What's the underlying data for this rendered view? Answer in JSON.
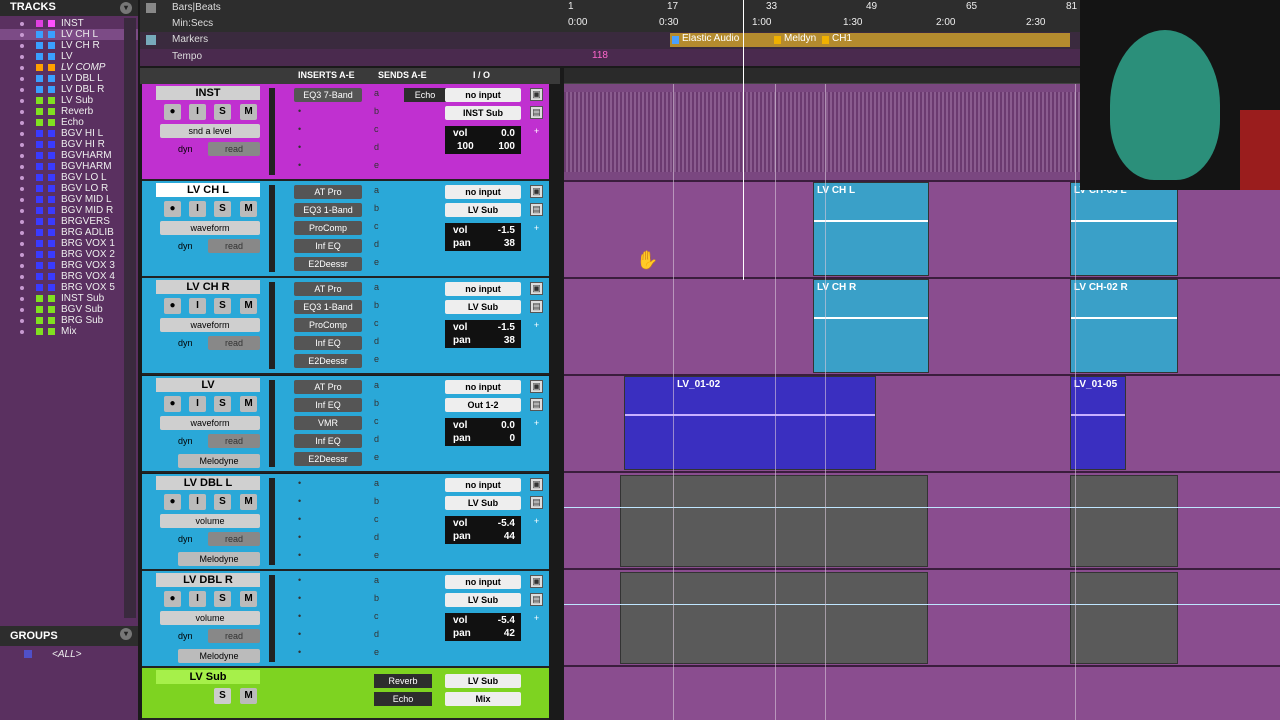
{
  "tracks_panel": {
    "title": "TRACKS",
    "items": [
      {
        "name": "INST",
        "c1": "#e040e0",
        "c2": "#ff50ff",
        "sel": false,
        "it": false
      },
      {
        "name": "LV CH L",
        "c1": "#3aa0ff",
        "c2": "#3aa0ff",
        "sel": true,
        "it": false
      },
      {
        "name": "LV CH R",
        "c1": "#3aa0ff",
        "c2": "#3aa0ff",
        "sel": false,
        "it": false
      },
      {
        "name": "LV",
        "c1": "#3aa0ff",
        "c2": "#3aa0ff",
        "sel": false,
        "it": false
      },
      {
        "name": "LV COMP",
        "c1": "#ffa000",
        "c2": "#ffa000",
        "sel": false,
        "it": true
      },
      {
        "name": "LV DBL L",
        "c1": "#3aa0ff",
        "c2": "#3aa0ff",
        "sel": false,
        "it": false
      },
      {
        "name": "LV DBL R",
        "c1": "#3aa0ff",
        "c2": "#3aa0ff",
        "sel": false,
        "it": false
      },
      {
        "name": "LV Sub",
        "c1": "#80e020",
        "c2": "#80e020",
        "sel": false,
        "it": false
      },
      {
        "name": "Reverb",
        "c1": "#80e020",
        "c2": "#80e020",
        "sel": false,
        "it": false
      },
      {
        "name": "Echo",
        "c1": "#80e020",
        "c2": "#80e020",
        "sel": false,
        "it": false
      },
      {
        "name": "BGV HI L",
        "c1": "#3a3aff",
        "c2": "#3a3aff",
        "sel": false,
        "it": false
      },
      {
        "name": "BGV HI R",
        "c1": "#3a3aff",
        "c2": "#3a3aff",
        "sel": false,
        "it": false
      },
      {
        "name": "BGVHARM",
        "c1": "#3a3aff",
        "c2": "#3a3aff",
        "sel": false,
        "it": false
      },
      {
        "name": "BGVHARM",
        "c1": "#3a3aff",
        "c2": "#3a3aff",
        "sel": false,
        "it": false
      },
      {
        "name": "BGV LO L",
        "c1": "#3a3aff",
        "c2": "#3a3aff",
        "sel": false,
        "it": false
      },
      {
        "name": "BGV LO R",
        "c1": "#3a3aff",
        "c2": "#3a3aff",
        "sel": false,
        "it": false
      },
      {
        "name": "BGV MID L",
        "c1": "#3a3aff",
        "c2": "#3a3aff",
        "sel": false,
        "it": false
      },
      {
        "name": "BGV MID R",
        "c1": "#3a3aff",
        "c2": "#3a3aff",
        "sel": false,
        "it": false
      },
      {
        "name": "BRGVERS",
        "c1": "#3a3aff",
        "c2": "#3a3aff",
        "sel": false,
        "it": false
      },
      {
        "name": "BRG ADLIB",
        "c1": "#3a3aff",
        "c2": "#3a3aff",
        "sel": false,
        "it": false
      },
      {
        "name": "BRG VOX 1",
        "c1": "#3a3aff",
        "c2": "#3a3aff",
        "sel": false,
        "it": false
      },
      {
        "name": "BRG VOX 2",
        "c1": "#3a3aff",
        "c2": "#3a3aff",
        "sel": false,
        "it": false
      },
      {
        "name": "BRG VOX 3",
        "c1": "#3a3aff",
        "c2": "#3a3aff",
        "sel": false,
        "it": false
      },
      {
        "name": "BRG VOX 4",
        "c1": "#3a3aff",
        "c2": "#3a3aff",
        "sel": false,
        "it": false
      },
      {
        "name": "BRG VOX 5",
        "c1": "#3a3aff",
        "c2": "#3a3aff",
        "sel": false,
        "it": false
      },
      {
        "name": "INST Sub",
        "c1": "#80e020",
        "c2": "#80e020",
        "sel": false,
        "it": false
      },
      {
        "name": "BGV Sub",
        "c1": "#80e020",
        "c2": "#80e020",
        "sel": false,
        "it": false
      },
      {
        "name": "BRG Sub",
        "c1": "#80e020",
        "c2": "#80e020",
        "sel": false,
        "it": false
      },
      {
        "name": "Mix",
        "c1": "#80e020",
        "c2": "#80e020",
        "sel": false,
        "it": false
      }
    ]
  },
  "groups_panel": {
    "title": "GROUPS",
    "all": "<ALL>"
  },
  "rulers": {
    "bars_beats": "Bars|Beats",
    "min_secs": "Min:Secs",
    "markers": "Markers",
    "tempo": "Tempo",
    "tempo_value": "118",
    "bar_ticks": [
      "1",
      "17",
      "33",
      "49",
      "65",
      "81"
    ],
    "time_ticks": [
      "0:00",
      "0:30",
      "1:00",
      "1:30",
      "2:00",
      "2:30"
    ],
    "marker_list": [
      "Elastic Audio",
      "Meldyn",
      "CH1"
    ]
  },
  "columns": {
    "inserts": "INSERTS A-E",
    "sends": "SENDS A-E",
    "io": "I / O"
  },
  "tracks": [
    {
      "name": "INST",
      "color": "#c030d0",
      "mode": "snd a level",
      "inserts": [
        "EQ3 7-Band",
        "",
        "",
        "",
        ""
      ],
      "sends": [
        "Echo",
        "",
        "",
        "",
        ""
      ],
      "input": "no input",
      "output": "INST Sub",
      "vol": "0.0",
      "pan_l": "100",
      "pan_r": "100",
      "row2": "",
      "plugin": ""
    },
    {
      "name": "LV CH L",
      "color": "#2aa8d8",
      "mode": "waveform",
      "inserts": [
        "AT Pro",
        "EQ3 1-Band",
        "ProComp",
        "Inf EQ",
        "E2Deessr"
      ],
      "sends": [
        "",
        "",
        "",
        "",
        ""
      ],
      "input": "no input",
      "output": "LV Sub",
      "vol": "-1.5",
      "pan": "38",
      "panlabel": "pan",
      "row2": "",
      "plugin": ""
    },
    {
      "name": "LV CH R",
      "color": "#2aa8d8",
      "mode": "waveform",
      "inserts": [
        "AT Pro",
        "EQ3 1-Band",
        "ProComp",
        "Inf EQ",
        "E2Deessr"
      ],
      "sends": [
        "",
        "",
        "",
        "",
        ""
      ],
      "input": "no input",
      "output": "LV Sub",
      "vol": "-1.5",
      "pan": "38",
      "panlabel": "pan",
      "row2": "",
      "plugin": ""
    },
    {
      "name": "LV",
      "color": "#2aa8d8",
      "mode": "waveform",
      "inserts": [
        "AT Pro",
        "Inf EQ",
        "VMR",
        "Inf EQ",
        "E2Deessr"
      ],
      "sends": [
        "",
        "",
        "",
        "",
        ""
      ],
      "input": "no input",
      "output": "Out 1-2",
      "vol": "0.0",
      "pan": "0",
      "panlabel": "pan",
      "row2": "",
      "plugin": "Melodyne"
    },
    {
      "name": "LV DBL L",
      "color": "#2aa8d8",
      "mode": "volume",
      "inserts": [
        "",
        "",
        "",
        "",
        ""
      ],
      "sends": [
        "",
        "",
        "",
        "",
        ""
      ],
      "input": "no input",
      "output": "LV Sub",
      "vol": "-5.4",
      "pan": "44",
      "panlabel": "pan",
      "row2": "",
      "plugin": "Melodyne"
    },
    {
      "name": "LV DBL R",
      "color": "#2aa8d8",
      "mode": "volume",
      "inserts": [
        "",
        "",
        "",
        "",
        ""
      ],
      "sends": [
        "",
        "",
        "",
        "",
        ""
      ],
      "input": "no input",
      "output": "LV Sub",
      "vol": "-5.4",
      "pan": "42",
      "panlabel": "pan",
      "row2": "",
      "plugin": "Melodyne"
    }
  ],
  "lv_sub": {
    "name": "LV Sub",
    "send_a": "Reverb",
    "send_b": "Echo",
    "input": "LV Sub",
    "output": "Mix"
  },
  "track_labels": {
    "vol": "vol",
    "dyn": "dyn",
    "read": "read",
    "slots": [
      "a",
      "b",
      "c",
      "d",
      "e"
    ]
  },
  "clips": {
    "lvchl_a": "LV CH L",
    "lvchl_b": "LV CH-03 L",
    "lvchr_a": "LV CH R",
    "lvchr_b": "LV CH-02 R",
    "lv_a": "LV_01-02",
    "lv_b": "LV_01-05"
  },
  "buttons": {
    "rec": "●",
    "input": "I",
    "solo": "S",
    "mute": "M"
  }
}
